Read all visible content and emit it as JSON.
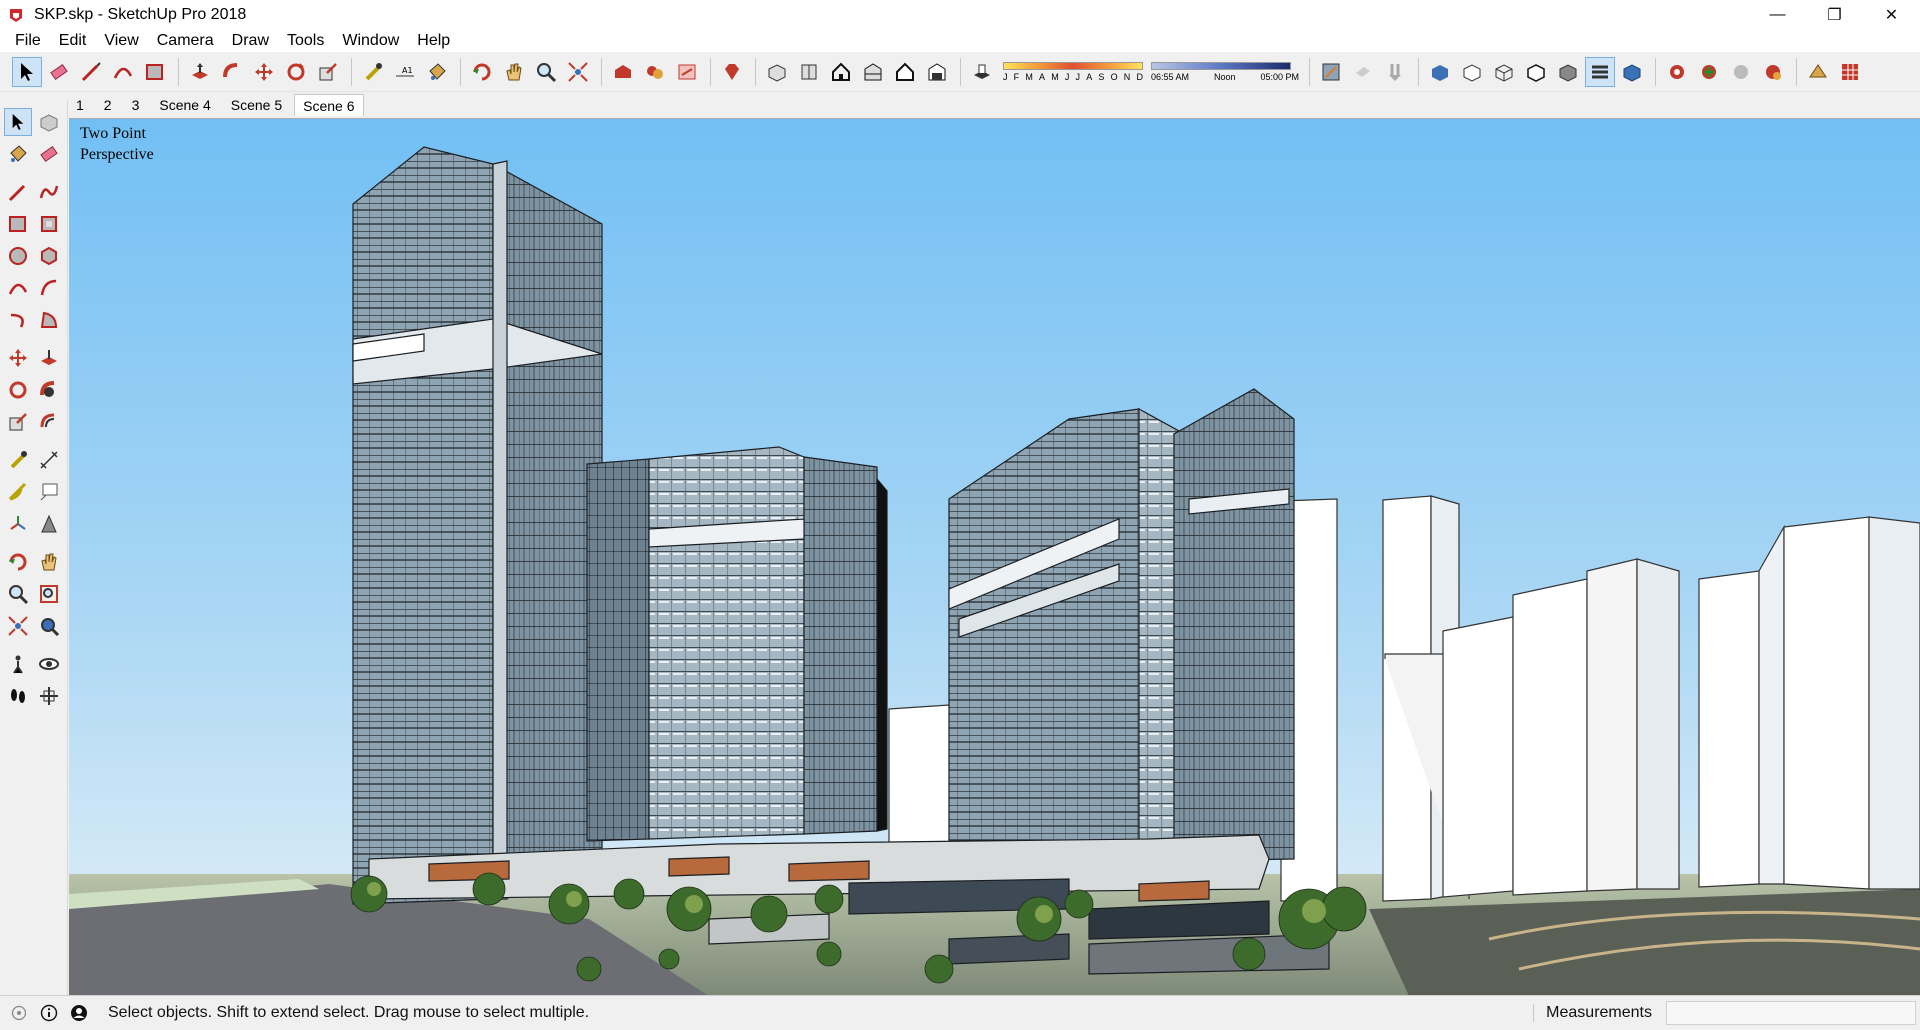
{
  "window": {
    "title": "SKP.skp - SketchUp Pro 2018",
    "minimize": "—",
    "maximize": "❐",
    "close": "✕"
  },
  "menu": [
    "File",
    "Edit",
    "View",
    "Camera",
    "Draw",
    "Tools",
    "Window",
    "Help"
  ],
  "toolbar": {
    "months": [
      "J",
      "F",
      "M",
      "A",
      "M",
      "J",
      "J",
      "A",
      "S",
      "O",
      "N",
      "D"
    ],
    "time_start": "06:55 AM",
    "time_mid": "Noon",
    "time_end": "05:00 PM"
  },
  "scene_tabs": [
    "1",
    "2",
    "3",
    "Scene 4",
    "Scene 5",
    "Scene 6"
  ],
  "active_scene": "Scene 6",
  "viewport": {
    "camera_label": "Two Point Perspective"
  },
  "status": {
    "message": "Select objects. Shift to extend select. Drag mouse to select multiple.",
    "measurements_label": "Measurements",
    "measurements_value": ""
  },
  "colors": {
    "sky_top": "#72bff4",
    "sky_bottom": "#e6f1f7",
    "accent": "#7ab0e0",
    "brand_red": "#d0262d"
  }
}
